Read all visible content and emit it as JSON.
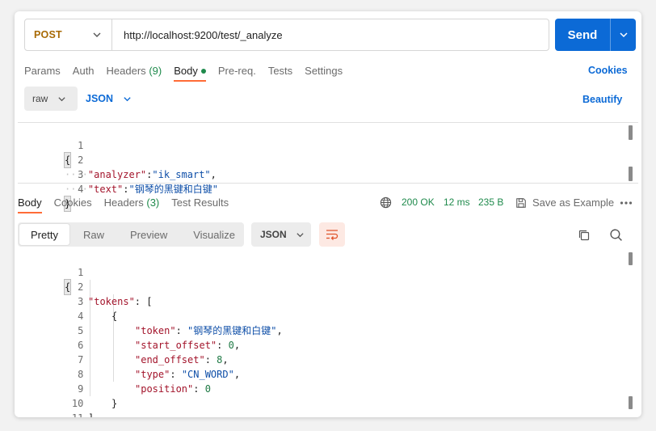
{
  "request": {
    "method": "POST",
    "url": "http://localhost:9200/test/_analyze",
    "send_label": "Send",
    "tabs": [
      {
        "label": "Params"
      },
      {
        "label": "Auth"
      },
      {
        "label": "Headers",
        "count": "(9)"
      },
      {
        "label": "Body"
      },
      {
        "label": "Pre-req."
      },
      {
        "label": "Tests"
      },
      {
        "label": "Settings"
      }
    ],
    "cookies_label": "Cookies",
    "body_mode": "raw",
    "body_format": "JSON",
    "beautify_label": "Beautify",
    "body_lines": [
      {
        "n": "1",
        "text": "{"
      },
      {
        "n": "2",
        "key": "\"analyzer\"",
        "val": "\"ik_smart\"",
        "tail": ","
      },
      {
        "n": "3",
        "key": "\"text\"",
        "val": "\"钢琴的黑键和白键\""
      },
      {
        "n": "4",
        "text": "}"
      }
    ]
  },
  "response": {
    "tabs": [
      {
        "label": "Body"
      },
      {
        "label": "Cookies"
      },
      {
        "label": "Headers",
        "count": "(3)"
      },
      {
        "label": "Test Results"
      }
    ],
    "status": "200 OK",
    "time": "12 ms",
    "size": "235 B",
    "save_label": "Save as Example",
    "views": [
      "Pretty",
      "Raw",
      "Preview",
      "Visualize"
    ],
    "format": "JSON",
    "lines": [
      {
        "n": "1",
        "text": "{"
      },
      {
        "n": "2",
        "key": "\"tokens\"",
        "tail": ": ["
      },
      {
        "n": "3",
        "text": "{"
      },
      {
        "n": "4",
        "key": "\"token\"",
        "str": "\"钢琴的黑键和白键\"",
        "tail": ","
      },
      {
        "n": "5",
        "key": "\"start_offset\"",
        "num": "0",
        "tail": ","
      },
      {
        "n": "6",
        "key": "\"end_offset\"",
        "num": "8",
        "tail": ","
      },
      {
        "n": "7",
        "key": "\"type\"",
        "str": "\"CN_WORD\"",
        "tail": ","
      },
      {
        "n": "8",
        "key": "\"position\"",
        "num": "0"
      },
      {
        "n": "9",
        "text": "}"
      },
      {
        "n": "10",
        "text": "]"
      },
      {
        "n": "11",
        "text": "}"
      }
    ]
  },
  "icons": [
    "chevron-down-icon",
    "globe-icon",
    "save-icon",
    "more-icon",
    "wrap-lines-icon",
    "copy-icon",
    "search-icon"
  ],
  "colors": {
    "accent": "#ff6c37",
    "primary": "#0c6ad6",
    "success": "#1f8a4c",
    "method": "#a86a05"
  }
}
